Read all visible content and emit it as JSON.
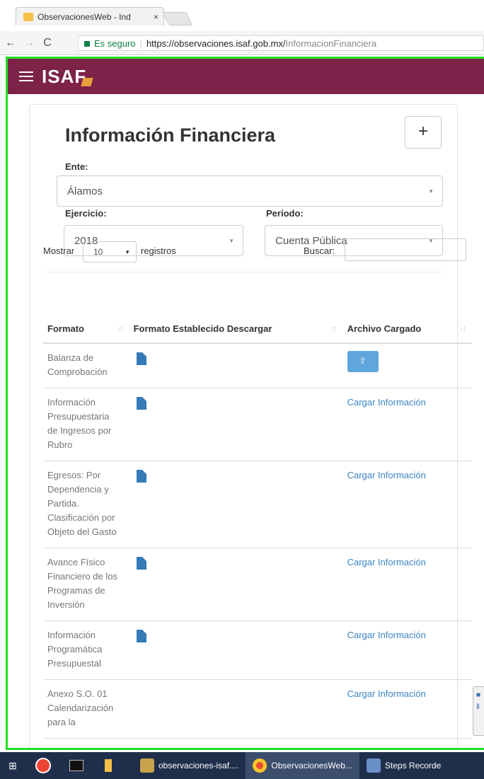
{
  "browser": {
    "tab_title": "ObservacionesWeb - Ind",
    "tab_close": "×",
    "secure_label": "Es seguro",
    "url_host": "https://observaciones.isaf.gob.mx/",
    "url_path": "InformacionFinanciera",
    "back": "←",
    "forward": "→",
    "reload": "C"
  },
  "header": {
    "brand": "ISAF"
  },
  "page": {
    "title": "Información Financiera",
    "add_button": "+",
    "ente_label": "Ente:",
    "ente_value": "Álamos",
    "ejercicio_label": "Ejercicio:",
    "ejercicio_value": "2018",
    "periodo_label": "Periodo:",
    "periodo_value": "Cuenta Pública"
  },
  "datatable": {
    "show_label": "Mostrar",
    "length_value": "10",
    "records_label": "registros",
    "search_label": "Buscar:",
    "columns": [
      "Formato",
      "Formato Establecido Descargar",
      "Archivo Cargado"
    ],
    "rows": [
      {
        "formato": "Balanza de Comprobación",
        "has_template": true,
        "archivo": "",
        "archivo_type": "upload-button"
      },
      {
        "formato": "Información Presupuestaria de Ingresos por Rubro",
        "has_template": true,
        "archivo": "Cargar Información",
        "archivo_type": "link"
      },
      {
        "formato": "Egresos: Por Dependencia y Partida. Clasificación por Objeto del Gasto",
        "has_template": true,
        "archivo": "Cargar Información",
        "archivo_type": "link"
      },
      {
        "formato": "Avance Físico Financiero de los Programas de Inversión",
        "has_template": true,
        "archivo": "Cargar Información",
        "archivo_type": "link"
      },
      {
        "formato": "Información Programática Presupuestal",
        "has_template": true,
        "archivo": "Cargar Información",
        "archivo_type": "link"
      },
      {
        "formato": "Anexo S.O. 01 Calendarización para la",
        "has_template": false,
        "archivo": "Cargar Información",
        "archivo_type": "link"
      }
    ]
  },
  "taskbar": {
    "items": [
      "observaciones-isaf....",
      "ObservacionesWeb...",
      "Steps Recorde"
    ]
  },
  "colors": {
    "navbar": "#7d2248",
    "accent_blue": "#337ab7",
    "link": "#3c85c4",
    "frame_green": "#22e022"
  }
}
